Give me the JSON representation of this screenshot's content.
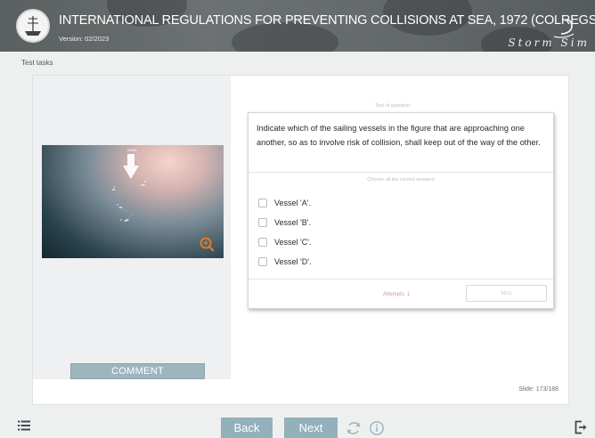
{
  "header": {
    "title": "INTERNATIONAL REGULATIONS FOR PREVENTING COLLISIONS AT SEA, 1972 (COLREGS)",
    "version": "Version: 02/2023",
    "brand": "Storm Sim"
  },
  "breadcrumb": "Test tasks",
  "figure": {
    "wind_label": "WIND",
    "vessel_labels": [
      "A",
      "B",
      "C",
      "D"
    ]
  },
  "comment_label": "COMMENT",
  "question": {
    "caption": "Text of question:",
    "text": "Indicate which of the sailing vessels in the figure that are approaching one another, so as to involve risk of collision, shall keep out of the way of the other.",
    "instruction": "Choose all the correct answers",
    "options": [
      "Vessel 'A'.",
      "Vessel 'B'.",
      "Vessel 'C'.",
      "Vessel 'D'."
    ],
    "attempts": "Attempts: 1",
    "miss_label": "Miss"
  },
  "slide_counter": "Slide: 173/188",
  "footer": {
    "back_label": "Back",
    "next_label": "Next"
  },
  "colors": {
    "accent": "#94b0ba",
    "zoom_icon": "#e07a2a",
    "header_bg": "#63686a"
  },
  "icons": [
    "menu-icon",
    "reload-icon",
    "info-icon",
    "exit-icon",
    "zoom-icon",
    "wind-arrow-icon"
  ]
}
